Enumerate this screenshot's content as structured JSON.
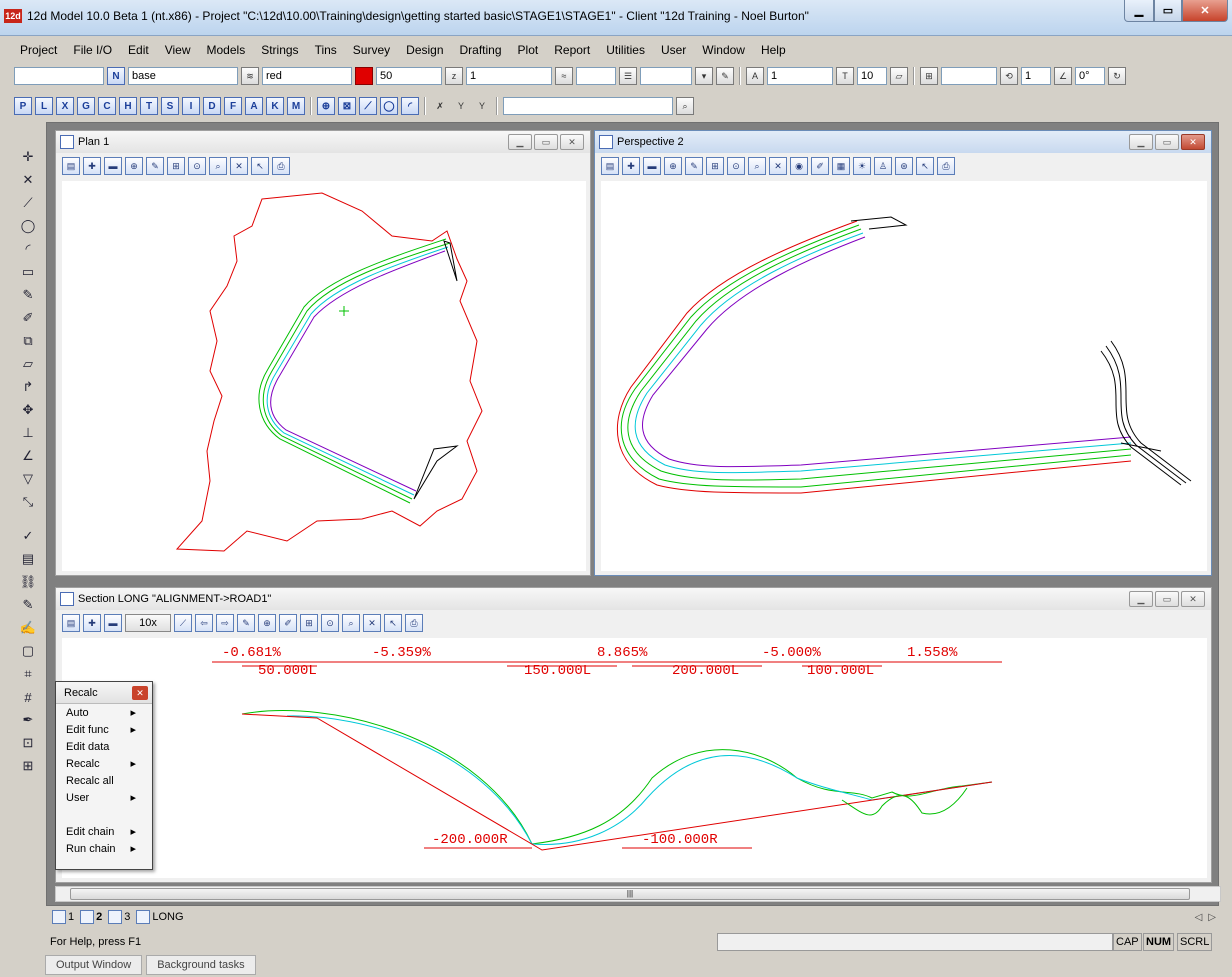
{
  "title": "12d Model 10.0 Beta 1 (nt.x86) - Project \"C:\\12d\\10.00\\Training\\design\\getting started basic\\STAGE1\\STAGE1\" - Client \"12d Training - Noel Burton\"",
  "app_icon": "12d",
  "menu": [
    "Project",
    "File I/O",
    "Edit",
    "View",
    "Models",
    "Strings",
    "Tins",
    "Survey",
    "Design",
    "Drafting",
    "Plot",
    "Report",
    "Utilities",
    "User",
    "Window",
    "Help"
  ],
  "toolbar1": {
    "model": "base",
    "colour": "red",
    "colour_swatch": "#e00000",
    "weight": "50",
    "z_value": "1",
    "text_size_1": "1",
    "text_height": "10",
    "spacing": "1",
    "angle": "0°"
  },
  "toolbar2_letters": [
    "P",
    "L",
    "X",
    "G",
    "C",
    "H",
    "T",
    "S",
    "I",
    "D",
    "F",
    "A",
    "K",
    "M"
  ],
  "plan": {
    "title": "Plan 1",
    "tools": [
      "▤",
      "✚",
      "▬",
      "⊕",
      "✎",
      "⊕",
      "⊙",
      "🔍",
      "✕",
      "↖",
      "⎙"
    ]
  },
  "perspective": {
    "title": "Perspective 2"
  },
  "section": {
    "title": "Section LONG \"ALIGNMENT->ROAD1\"",
    "zoom": "10x",
    "grades": [
      "-0.681%",
      "-5.359%",
      "8.865%",
      "-5.000%",
      "1.558%"
    ],
    "vc_lengths": [
      "50.000L",
      "150.000L",
      "200.000L",
      "100.000L"
    ],
    "radii": [
      "-200.000R",
      "-100.000R"
    ]
  },
  "context_menu": {
    "title": "Recalc",
    "items": [
      {
        "label": "Auto",
        "submenu": true
      },
      {
        "label": "Edit func",
        "submenu": true
      },
      {
        "label": "Edit data",
        "submenu": false
      },
      {
        "label": "Recalc",
        "submenu": true
      },
      {
        "label": "Recalc all",
        "submenu": false
      },
      {
        "label": "User",
        "submenu": true
      }
    ],
    "items2": [
      {
        "label": "Edit chain",
        "submenu": true
      },
      {
        "label": "Run chain",
        "submenu": true
      }
    ]
  },
  "tabs": [
    "1",
    "2",
    "3",
    "LONG"
  ],
  "status": {
    "help": "For Help, press F1",
    "cap": "CAP",
    "num": "NUM",
    "scrl": "SCRL"
  },
  "bottom_tabs": [
    "Output Window",
    "Background tasks"
  ],
  "colors": {
    "boundary": "#e00000",
    "road_green": "#00c000",
    "road_cyan": "#00c8d8",
    "road_purple": "#8000c0"
  }
}
